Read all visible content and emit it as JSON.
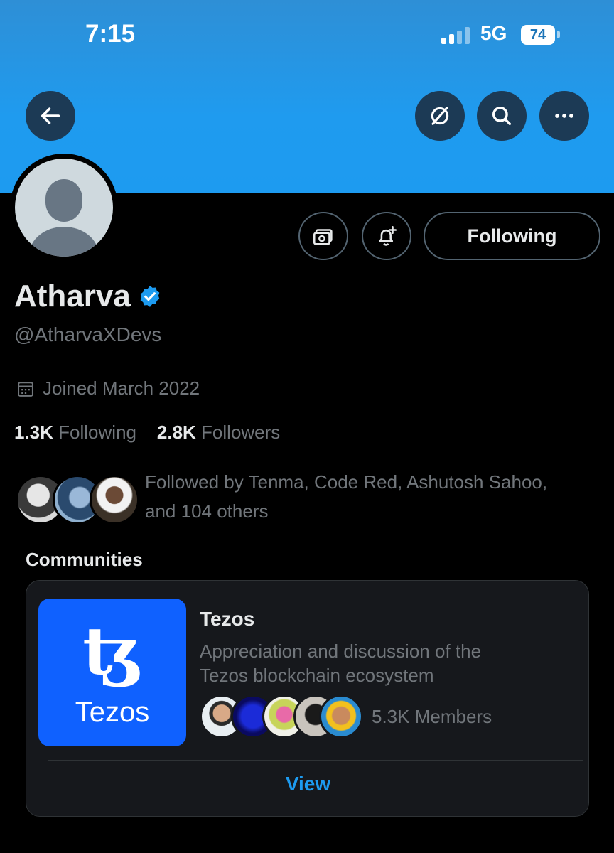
{
  "status_bar": {
    "time": "7:15",
    "network": "5G",
    "battery": "74"
  },
  "header": {
    "back_icon": "arrow-left-icon",
    "grok_icon": "slash-circle-icon",
    "search_icon": "search-icon",
    "more_icon": "more-horizontal-icon"
  },
  "profile": {
    "name": "Atharva",
    "handle": "@AtharvaXDevs",
    "verified_color": "#1d9bf0",
    "joined": "Joined March 2022",
    "following_count": "1.3K",
    "following_label": "Following",
    "followers_count": "2.8K",
    "followers_label": "Followers",
    "followed_by_line1": "Followed by Tenma, Code Red, Ashutosh Sahoo,",
    "followed_by_line2": "and 104 others"
  },
  "actions": {
    "subscribe_icon": "money-icon",
    "notify_icon": "bell-plus-icon",
    "following_button": "Following"
  },
  "communities": {
    "section_title": "Communities",
    "items": [
      {
        "logo_text": "Tezos",
        "logo_color": "#0f61ff",
        "name": "Tezos",
        "description_line1": "Appreciation and discussion of the",
        "description_line2": "Tezos blockchain ecosystem",
        "members": "5.3K Members",
        "view_label": "View"
      }
    ]
  },
  "colors": {
    "accent": "#1d9bf0",
    "banner": "#1d9bf0",
    "background": "#000000",
    "secondary_text": "#71767b"
  }
}
